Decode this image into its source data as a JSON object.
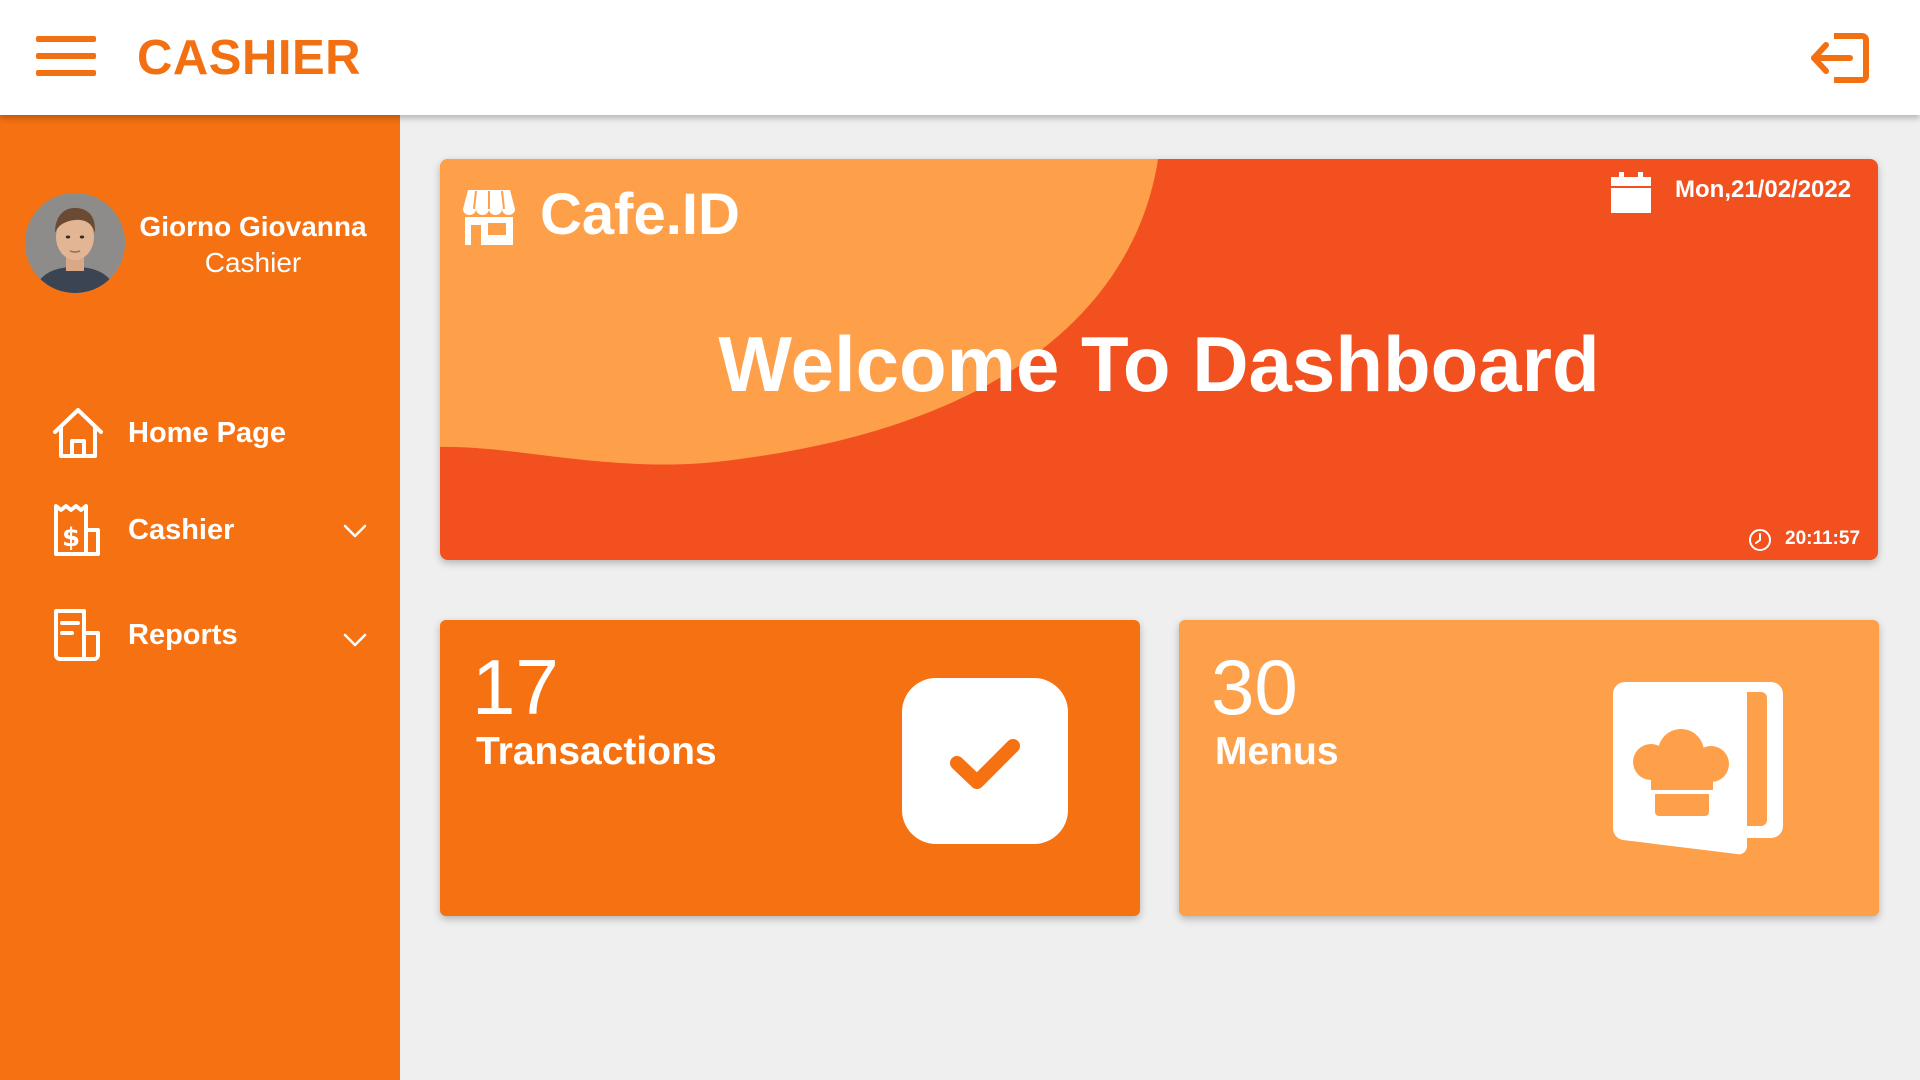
{
  "app": {
    "title": "CASHIER",
    "menu_icon": "hamburger-menu-icon",
    "logout_icon": "logout-icon"
  },
  "user": {
    "name": "Giorno Giovanna",
    "role": "Cashier"
  },
  "sidebar": {
    "items": [
      {
        "label": "Home Page",
        "icon": "home-icon",
        "has_submenu": false
      },
      {
        "label": "Cashier",
        "icon": "receipt-icon",
        "has_submenu": true
      },
      {
        "label": "Reports",
        "icon": "report-icon",
        "has_submenu": true
      }
    ]
  },
  "hero": {
    "brand": "Cafe.ID",
    "brand_icon": "store-icon",
    "date": "Mon,21/02/2022",
    "title": "Welcome To Dashboard",
    "time": "20:11:57"
  },
  "stats": [
    {
      "value": "17",
      "label": "Transactions",
      "icon": "check-icon",
      "color": "#f57112"
    },
    {
      "value": "30",
      "label": "Menus",
      "icon": "chef-menu-icon",
      "color": "#fea04a"
    }
  ],
  "colors": {
    "accent": "#f37012",
    "sidebar": "#f57112",
    "hero_bg": "#f2501f",
    "hero_wave": "#fea04a",
    "background": "#efefef"
  }
}
